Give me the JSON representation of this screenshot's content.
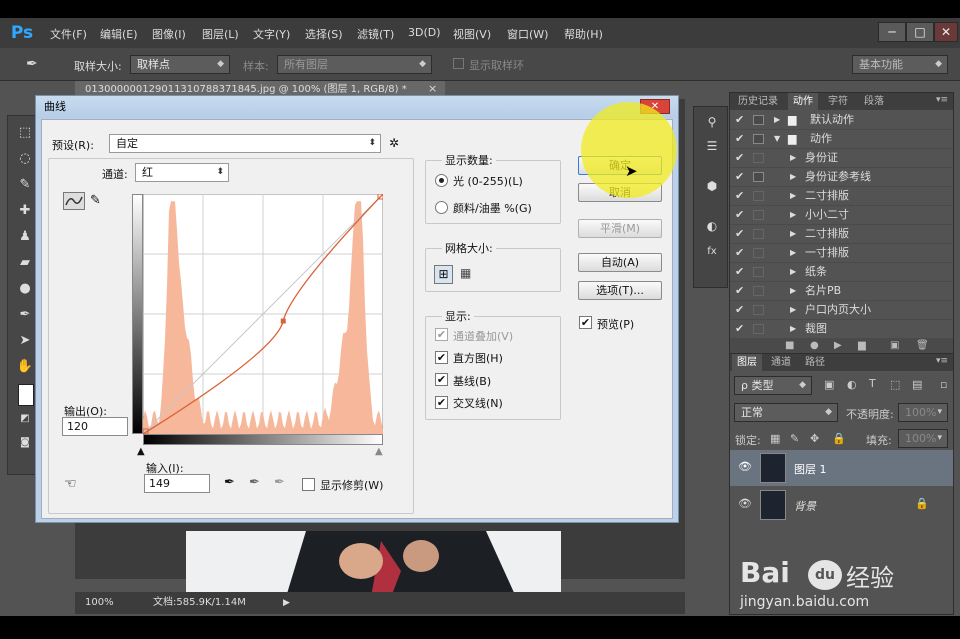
{
  "app": {
    "logo": "Ps"
  },
  "menu": [
    "文件(F)",
    "编辑(E)",
    "图像(I)",
    "图层(L)",
    "文字(Y)",
    "选择(S)",
    "滤镜(T)",
    "3D(D)",
    "视图(V)",
    "窗口(W)",
    "帮助(H)"
  ],
  "window_controls": {
    "minimize": "─",
    "restore": "□",
    "close": "✕"
  },
  "options": {
    "sample_size_label": "取样大小:",
    "sample_size_value": "取样点",
    "sample_label": "样本:",
    "sample_value": "所有图层",
    "show_ring_label": "显示取样环",
    "workspace": "基本功能"
  },
  "document": {
    "tab_title": "013000000129011310788371845.jpg @ 100% (图层 1, RGB/8) *",
    "tab_close": "×",
    "zoom": "100%",
    "doc_info": "文档:585.9K/1.14M"
  },
  "history_panel": {
    "tabs": [
      "历史记录",
      "动作",
      "字符",
      "段落"
    ],
    "active_tab": "动作",
    "actions": [
      {
        "label": "默认动作",
        "type": "set",
        "expanded": false
      },
      {
        "label": "动作",
        "type": "set",
        "expanded": true
      },
      {
        "label": "身份证",
        "type": "action"
      },
      {
        "label": "身份证参考线",
        "type": "action"
      },
      {
        "label": "二寸排版",
        "type": "action"
      },
      {
        "label": "小小二寸",
        "type": "action"
      },
      {
        "label": "二寸排版",
        "type": "action"
      },
      {
        "label": "一寸排版",
        "type": "action"
      },
      {
        "label": "纸条",
        "type": "action"
      },
      {
        "label": "名片PB",
        "type": "action"
      },
      {
        "label": "户口内页大小",
        "type": "action"
      },
      {
        "label": "裁图",
        "type": "action"
      }
    ]
  },
  "layers_panel": {
    "tabs": [
      "图层",
      "通道",
      "路径"
    ],
    "filter_kind": "ρ 类型",
    "blend_mode": "正常",
    "opacity_label": "不透明度:",
    "opacity_value": "100%",
    "lock_label": "锁定:",
    "fill_label": "填充:",
    "fill_value": "100%",
    "layers": [
      {
        "name": "图层 1",
        "selected": true
      },
      {
        "name": "背景",
        "selected": false,
        "locked": true
      }
    ]
  },
  "curves_dialog": {
    "title": "曲线",
    "preset_label": "预设(R):",
    "preset_value": "自定",
    "channel_label": "通道:",
    "channel_value": "红",
    "output_label": "输出(O):",
    "output_value": "120",
    "input_label": "输入(I):",
    "input_value": "149",
    "show_clipping_label": "显示修剪(W)",
    "buttons": {
      "ok": "确定",
      "cancel": "取消",
      "smooth": "平滑(M)",
      "auto": "自动(A)",
      "options": "选项(T)..."
    },
    "preview_label": "预览(P)",
    "show_amount_label": "显示数量:",
    "light_label": "光 (0-255)(L)",
    "pigment_label": "颜料/油墨 %(G)",
    "grid_size_label": "网格大小:",
    "show_label": "显示:",
    "show_options": [
      {
        "label": "通道叠加(V)",
        "checked": true,
        "disabled": true
      },
      {
        "label": "直方图(H)",
        "checked": true,
        "disabled": false
      },
      {
        "label": "基线(B)",
        "checked": true,
        "disabled": false
      },
      {
        "label": "交叉线(N)",
        "checked": true,
        "disabled": false
      }
    ],
    "curve_point": {
      "input": 149,
      "output": 120
    },
    "histogram_color": "#f7b79b",
    "curve_color": "#d9623a"
  },
  "watermark": {
    "brand": "Bai",
    "paw": "du",
    "cn": "经验",
    "url": "jingyan.baidu.com"
  }
}
